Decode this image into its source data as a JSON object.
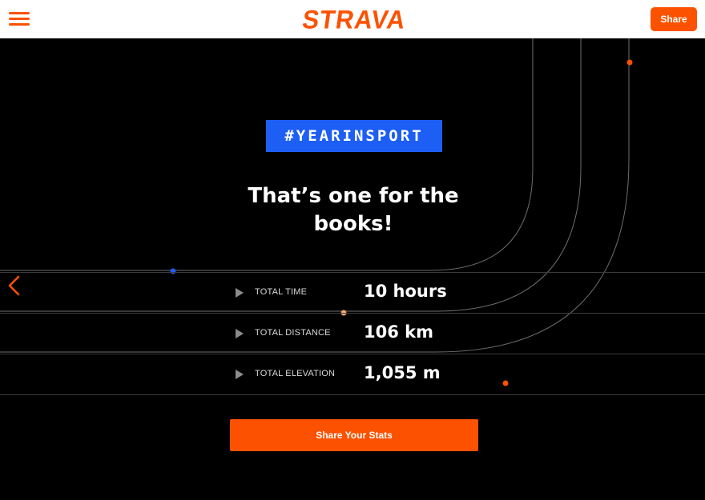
{
  "colors": {
    "accent": "#fc5200",
    "badge": "#1d5ef5",
    "line": "#6e6e6e"
  },
  "header": {
    "menu_icon": "hamburger-menu-icon",
    "logo_text": "STRAVA",
    "share_label": "Share"
  },
  "nav": {
    "back_icon": "chevron-left-icon"
  },
  "badge": {
    "text": "#YEARINSPORT"
  },
  "headline": {
    "line1": "That’s one for the",
    "line2": "books!"
  },
  "stats": [
    {
      "label": "TOTAL TIME",
      "value": "10 hours",
      "icon": "play-triangle-icon"
    },
    {
      "label": "TOTAL DISTANCE",
      "value": "106 km",
      "icon": "play-triangle-icon"
    },
    {
      "label": "TOTAL ELEVATION",
      "value": "1,055 m",
      "icon": "play-triangle-icon"
    }
  ],
  "cta": {
    "label": "Share Your Stats"
  }
}
